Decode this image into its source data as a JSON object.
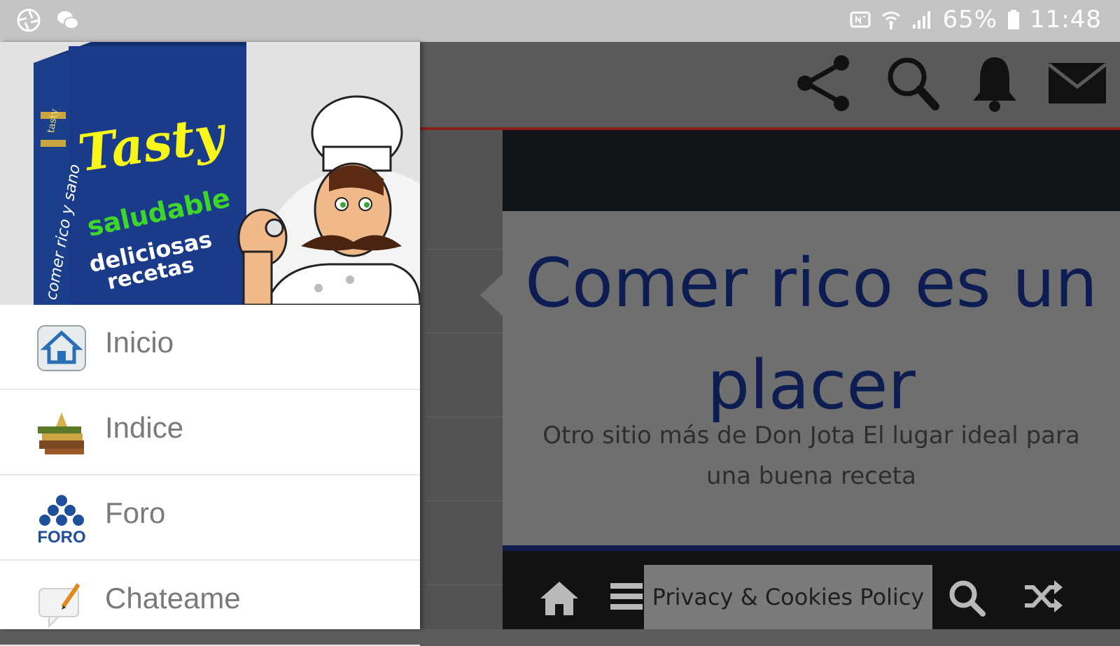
{
  "status_bar": {
    "battery": "65%",
    "time": "11:48"
  },
  "header_icons": [
    "share-icon",
    "search-icon",
    "bell-icon",
    "mail-icon"
  ],
  "banner": {
    "book_title": "Tasty",
    "book_line1": "saludable",
    "book_line2": "deliciosas",
    "book_line3": "recetas",
    "book_spine": "comer rico y sano",
    "book_top": "tasty"
  },
  "menu": {
    "items": [
      {
        "label": "Inicio",
        "icon": "home-icon"
      },
      {
        "label": "Indice",
        "icon": "books-icon"
      },
      {
        "label": "Foro",
        "icon": "forum-icon",
        "icon_text": "FORO"
      },
      {
        "label": "Chateame",
        "icon": "chat-icon"
      }
    ]
  },
  "hero": {
    "title": "Comer rico es un placer",
    "subtitle": "Otro sitio más de Don Jota El lugar ideal para una buena receta"
  },
  "footer": {
    "privacy_label": "Privacy & Cookies Policy",
    "icons": [
      "home-icon",
      "menu-icon",
      "search-icon",
      "shuffle-icon"
    ]
  },
  "colors": {
    "accent_red": "#8c1d1d",
    "title_blue": "#0d1d52",
    "book_blue": "#1a3a8a",
    "tasty_yellow": "#f7f51a",
    "saludable_green": "#3fd62a"
  }
}
